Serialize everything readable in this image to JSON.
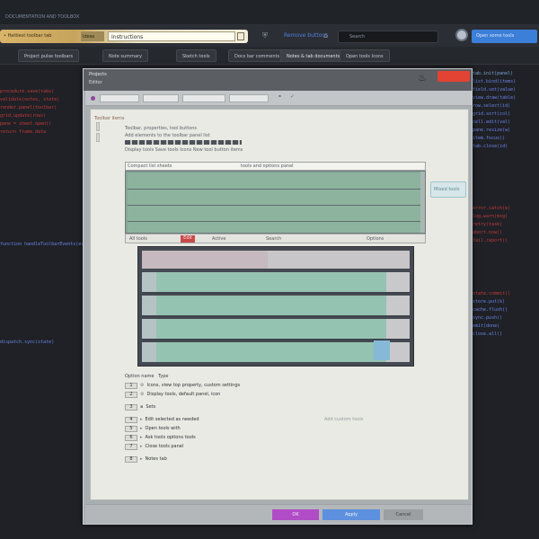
{
  "window": {
    "title": "DOCUMENTATION AND TOOLBOX"
  },
  "toolbar": {
    "address_label": "• Hattiest toolbar tab",
    "address_chip": "Ideas",
    "address_value": "Instructions",
    "link": "Remove buttons",
    "search_placeholder": "Search",
    "right_button": "Open some tools"
  },
  "tabs": [
    {
      "label": "Project pulse toolbars"
    },
    {
      "label": "Note summary"
    },
    {
      "label": "Sketch tools"
    },
    {
      "label": "Docs bar comments"
    },
    {
      "label": "Notes & tab documents"
    },
    {
      "label": "Open tools Icons"
    }
  ],
  "left_code": [
    {
      "text": "procedure.save(tabs)",
      "color": "red"
    },
    {
      "text": "validate(notes, state)",
      "color": "red"
    },
    {
      "text": "render.panel(toolbar)",
      "color": "red"
    },
    {
      "text": "  grid.update(rows)",
      "color": "red"
    },
    {
      "text": "  pane = sheet.open()",
      "color": "red"
    },
    {
      "text": "  return frame.data",
      "color": "red"
    }
  ],
  "left_code_mid": "  function handleToolbarEvents(ev)",
  "left_code_low": "  dispatch.sync(state)",
  "right_code": [
    {
      "text": "tab.init(panel)",
      "color": "cyan"
    },
    {
      "text": "  list.bind(items)",
      "color": "blue"
    },
    {
      "text": "  field.set(value)",
      "color": "blue"
    },
    {
      "text": "  view.draw(table)",
      "color": "blue"
    },
    {
      "text": "  row.select(id)",
      "color": "blue"
    },
    {
      "text": "  grid.sort(col)",
      "color": "blue"
    },
    {
      "text": "  cell.edit(val)",
      "color": "blue"
    },
    {
      "text": "  pane.resize(w)",
      "color": "blue"
    },
    {
      "text": "  item.focus()",
      "color": "blue"
    },
    {
      "text": "  tab.close(id)",
      "color": "blue"
    }
  ],
  "right_code_mid": [
    {
      "text": "error.catch(e)",
      "color": "red"
    },
    {
      "text": "  log.warn(msg)",
      "color": "red"
    },
    {
      "text": "  retry(task)",
      "color": "red"
    },
    {
      "text": "  abort.now()",
      "color": "red"
    },
    {
      "text": "  fail.report()",
      "color": "red"
    }
  ],
  "right_code_low": [
    {
      "text": "state.commit()",
      "color": "red"
    },
    {
      "text": "  store.put(k)",
      "color": "blue"
    },
    {
      "text": "  cache.flush()",
      "color": "blue"
    },
    {
      "text": "  sync.push()",
      "color": "blue"
    },
    {
      "text": "  emit(done)",
      "color": "blue"
    },
    {
      "text": "  close.all()",
      "color": "blue"
    }
  ],
  "dialog": {
    "title": "Projects",
    "subtitle": "Editor",
    "panel_title": "Toolbar items",
    "lines": [
      "Toolbar, properties, tool buttons",
      "Add elements to the toolbar panel list",
      "Display tools  Save tools  Icons  New tool button items"
    ],
    "grid1_head": "Compact list sheets",
    "grid1_head2": "tools and options panel",
    "grid1_foot": [
      "All tools",
      "Active",
      "Search",
      "Options",
      "Notes"
    ],
    "red_tag": "Edit",
    "side_badge": "Mixed tools",
    "list_head": "Option name",
    "list_head2": "Type",
    "rows": [
      {
        "num": "1",
        "text": "Icons, view top property, custom settings",
        "tag": ""
      },
      {
        "num": "2",
        "text": "Display tools, default panel, icon",
        "tag": ""
      },
      {
        "num": "3",
        "text": "Sets",
        "tag": ""
      },
      {
        "num": "4",
        "text": "Edit selected as needed",
        "tag": ""
      },
      {
        "num": "5",
        "text": "Open tools with",
        "tag": ""
      },
      {
        "num": "6",
        "text": "Ask tools options tools",
        "tag": ""
      },
      {
        "num": "7",
        "text": "Close tools panel",
        "tag": ""
      },
      {
        "num": "8",
        "text": "Notes tab",
        "tag": ""
      }
    ],
    "list_right": "Add custom tools",
    "footer": {
      "b1": "OK",
      "b2": "Apply",
      "b3": "Cancel"
    }
  }
}
